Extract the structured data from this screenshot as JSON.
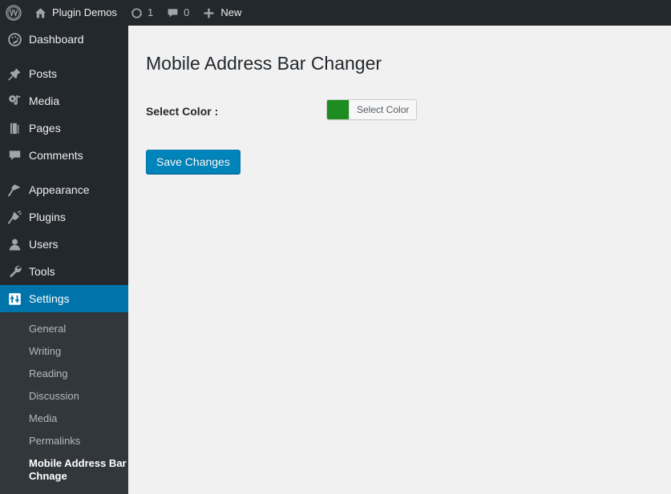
{
  "adminbar": {
    "wp_logo": {
      "icon": "wordpress-logo-icon",
      "label": ""
    },
    "site_name": {
      "icon": "home-icon",
      "label": "Plugin Demos"
    },
    "updates": {
      "icon": "updates-icon",
      "count": "1"
    },
    "comments": {
      "icon": "comment-bubble-icon",
      "count": "0"
    },
    "new": {
      "icon": "plus-icon",
      "label": "New"
    }
  },
  "sidebar": {
    "items": [
      {
        "label": "Dashboard",
        "icon": "dashboard-icon",
        "current": false,
        "separator_after": true
      },
      {
        "label": "Posts",
        "icon": "pin-icon",
        "current": false,
        "separator_after": false
      },
      {
        "label": "Media",
        "icon": "media-icon",
        "current": false,
        "separator_after": false
      },
      {
        "label": "Pages",
        "icon": "pages-icon",
        "current": false,
        "separator_after": false
      },
      {
        "label": "Comments",
        "icon": "comment-icon",
        "current": false,
        "separator_after": true
      },
      {
        "label": "Appearance",
        "icon": "appearance-brush-icon",
        "current": false,
        "separator_after": false
      },
      {
        "label": "Plugins",
        "icon": "plugins-plug-icon",
        "current": false,
        "separator_after": false
      },
      {
        "label": "Users",
        "icon": "users-icon",
        "current": false,
        "separator_after": false
      },
      {
        "label": "Tools",
        "icon": "tools-wrench-icon",
        "current": false,
        "separator_after": false
      },
      {
        "label": "Settings",
        "icon": "settings-sliders-icon",
        "current": true,
        "separator_after": false
      }
    ],
    "submenu": [
      {
        "label": "General",
        "current": false
      },
      {
        "label": "Writing",
        "current": false
      },
      {
        "label": "Reading",
        "current": false
      },
      {
        "label": "Discussion",
        "current": false
      },
      {
        "label": "Media",
        "current": false
      },
      {
        "label": "Permalinks",
        "current": false
      },
      {
        "label": "Mobile Address Bar Chnage",
        "current": true
      }
    ]
  },
  "main": {
    "page_title": "Mobile Address Bar Changer",
    "fields": [
      {
        "label": "Select Color :",
        "control": "color-picker",
        "color_value": "#1e8c20",
        "button_text": "Select Color"
      }
    ],
    "submit_label": "Save Changes"
  },
  "colors": {
    "admin_dark": "#23282d",
    "submenu_bg": "#32373c",
    "accent_blue": "#0073aa",
    "button_blue": "#0085ba",
    "content_bg": "#f1f1f1",
    "picked_green": "#1e8c20"
  }
}
